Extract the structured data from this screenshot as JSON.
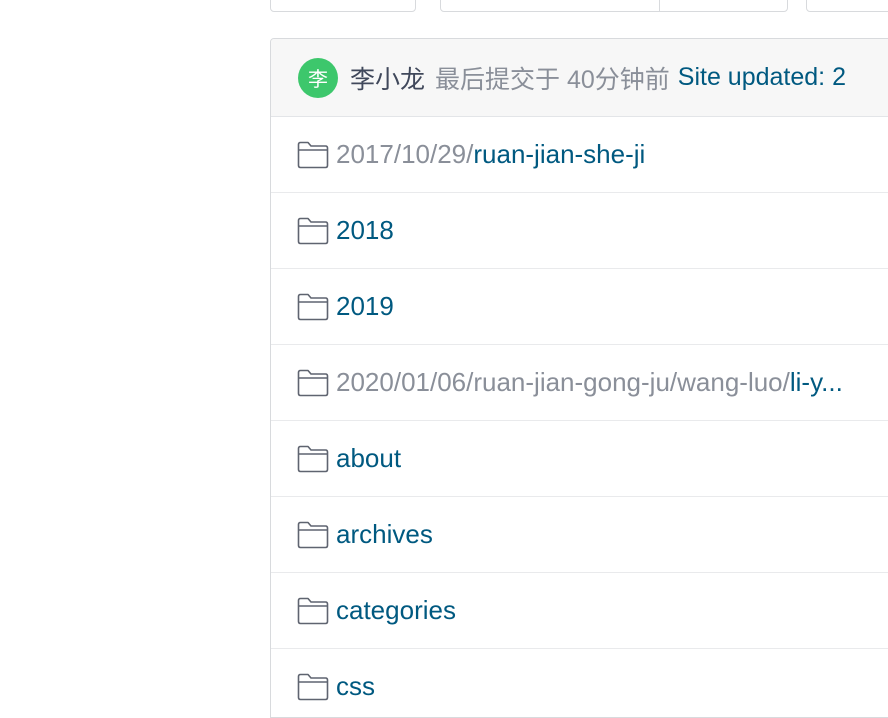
{
  "commit": {
    "avatar_char": "李",
    "author": "李小龙",
    "meta": "最后提交于 40分钟前",
    "message": "Site updated: 2"
  },
  "colors": {
    "avatar": "#3dc76c",
    "link": "#005980",
    "muted": "#8a8f99"
  },
  "files": [
    {
      "prefix": "2017/10/29/",
      "name": "ruan-jian-she-ji",
      "icon": "folder-icon"
    },
    {
      "prefix": "",
      "name": "2018",
      "icon": "folder-icon"
    },
    {
      "prefix": "",
      "name": "2019",
      "icon": "folder-icon"
    },
    {
      "prefix": "2020/01/06/ruan-jian-gong-ju/wang-luo/",
      "name": "li-y...",
      "icon": "folder-icon"
    },
    {
      "prefix": "",
      "name": "about",
      "icon": "folder-icon"
    },
    {
      "prefix": "",
      "name": "archives",
      "icon": "folder-icon"
    },
    {
      "prefix": "",
      "name": "categories",
      "icon": "folder-icon"
    },
    {
      "prefix": "",
      "name": "css",
      "icon": "folder-icon"
    }
  ]
}
